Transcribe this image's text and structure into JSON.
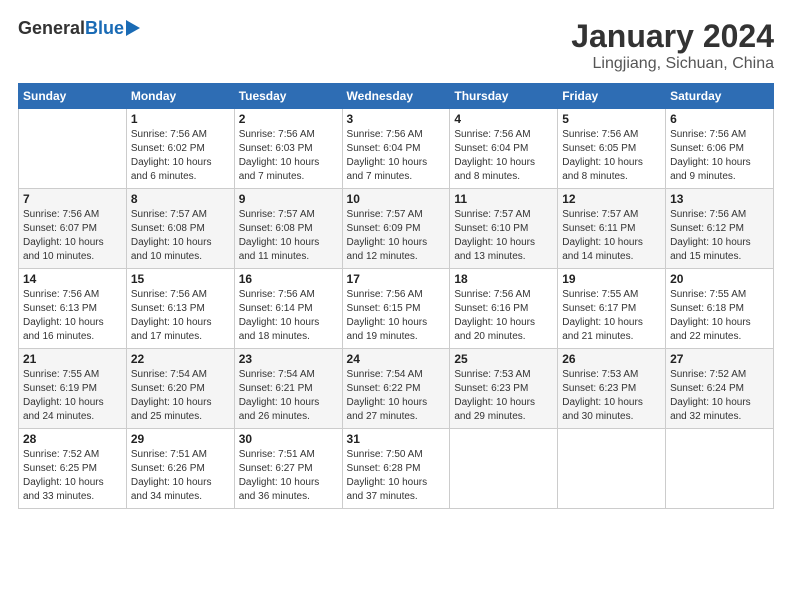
{
  "header": {
    "logo_general": "General",
    "logo_blue": "Blue",
    "main_title": "January 2024",
    "subtitle": "Lingjiang, Sichuan, China"
  },
  "columns": [
    "Sunday",
    "Monday",
    "Tuesday",
    "Wednesday",
    "Thursday",
    "Friday",
    "Saturday"
  ],
  "weeks": [
    [
      {
        "day": "",
        "info": ""
      },
      {
        "day": "1",
        "info": "Sunrise: 7:56 AM\nSunset: 6:02 PM\nDaylight: 10 hours\nand 6 minutes."
      },
      {
        "day": "2",
        "info": "Sunrise: 7:56 AM\nSunset: 6:03 PM\nDaylight: 10 hours\nand 7 minutes."
      },
      {
        "day": "3",
        "info": "Sunrise: 7:56 AM\nSunset: 6:04 PM\nDaylight: 10 hours\nand 7 minutes."
      },
      {
        "day": "4",
        "info": "Sunrise: 7:56 AM\nSunset: 6:04 PM\nDaylight: 10 hours\nand 8 minutes."
      },
      {
        "day": "5",
        "info": "Sunrise: 7:56 AM\nSunset: 6:05 PM\nDaylight: 10 hours\nand 8 minutes."
      },
      {
        "day": "6",
        "info": "Sunrise: 7:56 AM\nSunset: 6:06 PM\nDaylight: 10 hours\nand 9 minutes."
      }
    ],
    [
      {
        "day": "7",
        "info": "Sunrise: 7:56 AM\nSunset: 6:07 PM\nDaylight: 10 hours\nand 10 minutes."
      },
      {
        "day": "8",
        "info": "Sunrise: 7:57 AM\nSunset: 6:08 PM\nDaylight: 10 hours\nand 10 minutes."
      },
      {
        "day": "9",
        "info": "Sunrise: 7:57 AM\nSunset: 6:08 PM\nDaylight: 10 hours\nand 11 minutes."
      },
      {
        "day": "10",
        "info": "Sunrise: 7:57 AM\nSunset: 6:09 PM\nDaylight: 10 hours\nand 12 minutes."
      },
      {
        "day": "11",
        "info": "Sunrise: 7:57 AM\nSunset: 6:10 PM\nDaylight: 10 hours\nand 13 minutes."
      },
      {
        "day": "12",
        "info": "Sunrise: 7:57 AM\nSunset: 6:11 PM\nDaylight: 10 hours\nand 14 minutes."
      },
      {
        "day": "13",
        "info": "Sunrise: 7:56 AM\nSunset: 6:12 PM\nDaylight: 10 hours\nand 15 minutes."
      }
    ],
    [
      {
        "day": "14",
        "info": "Sunrise: 7:56 AM\nSunset: 6:13 PM\nDaylight: 10 hours\nand 16 minutes."
      },
      {
        "day": "15",
        "info": "Sunrise: 7:56 AM\nSunset: 6:13 PM\nDaylight: 10 hours\nand 17 minutes."
      },
      {
        "day": "16",
        "info": "Sunrise: 7:56 AM\nSunset: 6:14 PM\nDaylight: 10 hours\nand 18 minutes."
      },
      {
        "day": "17",
        "info": "Sunrise: 7:56 AM\nSunset: 6:15 PM\nDaylight: 10 hours\nand 19 minutes."
      },
      {
        "day": "18",
        "info": "Sunrise: 7:56 AM\nSunset: 6:16 PM\nDaylight: 10 hours\nand 20 minutes."
      },
      {
        "day": "19",
        "info": "Sunrise: 7:55 AM\nSunset: 6:17 PM\nDaylight: 10 hours\nand 21 minutes."
      },
      {
        "day": "20",
        "info": "Sunrise: 7:55 AM\nSunset: 6:18 PM\nDaylight: 10 hours\nand 22 minutes."
      }
    ],
    [
      {
        "day": "21",
        "info": "Sunrise: 7:55 AM\nSunset: 6:19 PM\nDaylight: 10 hours\nand 24 minutes."
      },
      {
        "day": "22",
        "info": "Sunrise: 7:54 AM\nSunset: 6:20 PM\nDaylight: 10 hours\nand 25 minutes."
      },
      {
        "day": "23",
        "info": "Sunrise: 7:54 AM\nSunset: 6:21 PM\nDaylight: 10 hours\nand 26 minutes."
      },
      {
        "day": "24",
        "info": "Sunrise: 7:54 AM\nSunset: 6:22 PM\nDaylight: 10 hours\nand 27 minutes."
      },
      {
        "day": "25",
        "info": "Sunrise: 7:53 AM\nSunset: 6:23 PM\nDaylight: 10 hours\nand 29 minutes."
      },
      {
        "day": "26",
        "info": "Sunrise: 7:53 AM\nSunset: 6:23 PM\nDaylight: 10 hours\nand 30 minutes."
      },
      {
        "day": "27",
        "info": "Sunrise: 7:52 AM\nSunset: 6:24 PM\nDaylight: 10 hours\nand 32 minutes."
      }
    ],
    [
      {
        "day": "28",
        "info": "Sunrise: 7:52 AM\nSunset: 6:25 PM\nDaylight: 10 hours\nand 33 minutes."
      },
      {
        "day": "29",
        "info": "Sunrise: 7:51 AM\nSunset: 6:26 PM\nDaylight: 10 hours\nand 34 minutes."
      },
      {
        "day": "30",
        "info": "Sunrise: 7:51 AM\nSunset: 6:27 PM\nDaylight: 10 hours\nand 36 minutes."
      },
      {
        "day": "31",
        "info": "Sunrise: 7:50 AM\nSunset: 6:28 PM\nDaylight: 10 hours\nand 37 minutes."
      },
      {
        "day": "",
        "info": ""
      },
      {
        "day": "",
        "info": ""
      },
      {
        "day": "",
        "info": ""
      }
    ]
  ]
}
